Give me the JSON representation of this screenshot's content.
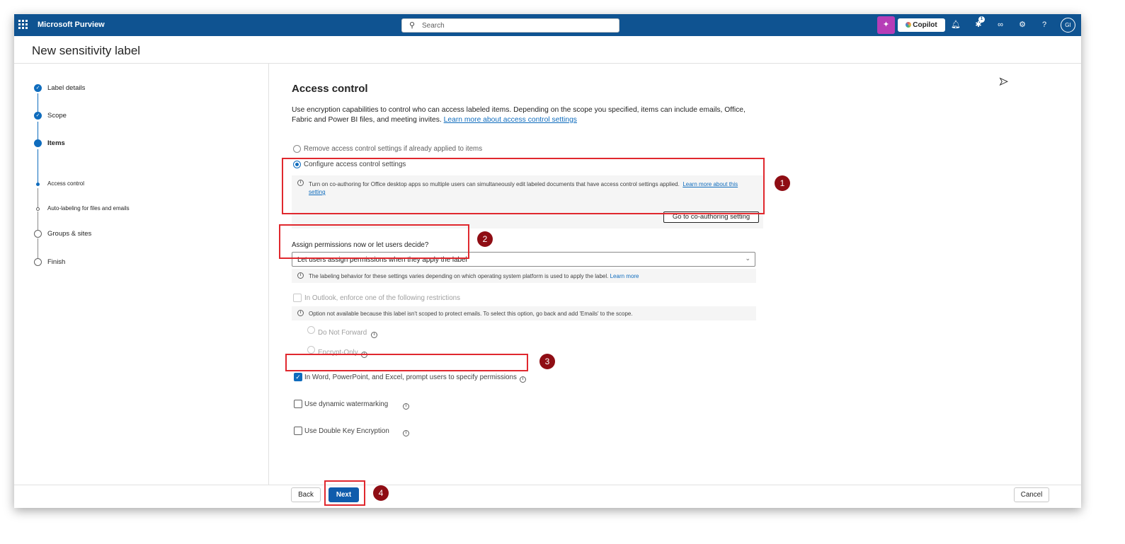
{
  "topbar": {
    "app_title": "Microsoft Purview",
    "search_placeholder": "Search",
    "copilot_label": "Copilot",
    "notification_count": "1",
    "avatar_initials": "GI"
  },
  "page": {
    "title": "New sensitivity label"
  },
  "stepper": {
    "steps": [
      {
        "label": "Label details",
        "state": "done"
      },
      {
        "label": "Scope",
        "state": "done"
      },
      {
        "label": "Items",
        "state": "current"
      },
      {
        "label": "Access control",
        "state": "current-sub"
      },
      {
        "label": "Auto-labeling for files and emails",
        "state": "todo-sub"
      },
      {
        "label": "Groups & sites",
        "state": "todo"
      },
      {
        "label": "Finish",
        "state": "todo"
      }
    ]
  },
  "access_control": {
    "title": "Access control",
    "intro": "Use encryption capabilities to control who can access labeled items. Depending on the scope you specified, items can include emails, Office, Fabric and Power BI files, and meeting invites.",
    "intro_link": "Learn more about access control settings",
    "option_remove": "Remove access control settings if already applied to items",
    "option_configure": "Configure access control settings",
    "coauthor_info": "Turn on co-authoring for Office desktop apps so multiple users can simultaneously edit labeled documents that have access control settings applied.",
    "coauthor_link": "Learn more about this setting",
    "coauthor_button": "Go to co-authoring setting",
    "permissions_label": "Assign permissions now or let users decide?",
    "permissions_value": "Let users assign permissions when they apply the label",
    "platform_info": "The labeling behavior for these settings varies depending on which operating system platform is used to apply the label.",
    "platform_link": "Learn more",
    "outlook_restrict": "In Outlook, enforce one of the following restrictions",
    "outlook_info": "Option not available because this label isn't scoped to protect emails. To select this option, go back and add 'Emails' to the scope.",
    "do_not_forward": "Do Not Forward",
    "encrypt_only": "Encrypt-Only",
    "prompt_users": "In Word, PowerPoint, and Excel, prompt users to specify permissions",
    "prompt_users_checked": true,
    "dynamic_watermarking": "Use dynamic watermarking",
    "double_key": "Use Double Key Encryption"
  },
  "annotations": [
    "1",
    "2",
    "3",
    "4"
  ],
  "footer": {
    "back": "Back",
    "next": "Next",
    "cancel": "Cancel"
  },
  "colors": {
    "topbar": "#0f5391",
    "accent": "#0f6cbd",
    "highlight": "#e0282e",
    "badge": "#8f0d14"
  }
}
